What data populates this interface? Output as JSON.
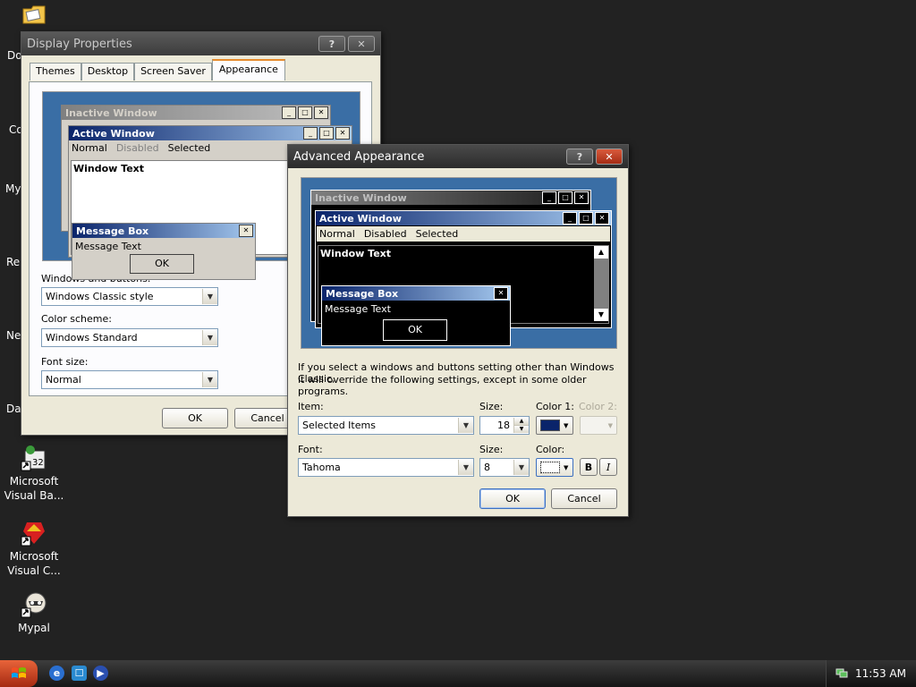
{
  "desktop": {
    "partial_labels": [
      "Do",
      "Co",
      "My",
      "Re",
      "Ne",
      "Da"
    ],
    "icons": [
      {
        "line1": "Microsoft",
        "line2": "Visual Ba..."
      },
      {
        "line1": "Microsoft",
        "line2": "Visual C..."
      },
      {
        "line1": "Mypal",
        "line2": ""
      }
    ]
  },
  "display_properties": {
    "title": "Display Properties",
    "help_label": "?",
    "close_label": "✕",
    "tabs": [
      "Themes",
      "Desktop",
      "Screen Saver",
      "Appearance"
    ],
    "preview": {
      "inactive_title": "Inactive Window",
      "active_title": "Active Window",
      "menu": [
        "Normal",
        "Disabled",
        "Selected"
      ],
      "window_text": "Window Text",
      "msgbox_title": "Message Box",
      "msgbox_text": "Message Text",
      "ok_label": "OK"
    },
    "windows_buttons_label": "Windows and buttons:",
    "windows_buttons_value": "Windows Classic style",
    "color_scheme_label": "Color scheme:",
    "color_scheme_value": "Windows Standard",
    "font_size_label": "Font size:",
    "font_size_value": "Normal",
    "ok_label": "OK",
    "cancel_label": "Cancel"
  },
  "advanced_appearance": {
    "title": "Advanced Appearance",
    "help_label": "?",
    "close_label": "✕",
    "preview": {
      "inactive_title": "Inactive Window",
      "active_title": "Active Window",
      "menu": [
        "Normal",
        "Disabled",
        "Selected"
      ],
      "window_text": "Window Text",
      "msgbox_title": "Message Box",
      "msgbox_text": "Message Text",
      "ok_label": "OK"
    },
    "notice_line1": "If you select a windows and buttons setting other than Windows Classic,",
    "notice_line2": "it will override the following settings, except in some older programs.",
    "item_label": "Item:",
    "item_value": "Selected Items",
    "size_label": "Size:",
    "item_size_value": "18",
    "color1_label": "Color 1:",
    "color2_label": "Color 2:",
    "font_label": "Font:",
    "font_value": "Tahoma",
    "font_size_label": "Size:",
    "font_size_value": "8",
    "color_label": "Color:",
    "bold_label": "B",
    "italic_label": "I",
    "ok_label": "OK",
    "cancel_label": "Cancel"
  },
  "taskbar": {
    "clock": "11:53 AM"
  },
  "colors": {
    "desktop_bg": "#222222",
    "dialog_bg": "#ece9d8",
    "preview_bg": "#3a6ea5",
    "active_caption": "#0a246a",
    "color1_swatch": "#0a246a"
  }
}
